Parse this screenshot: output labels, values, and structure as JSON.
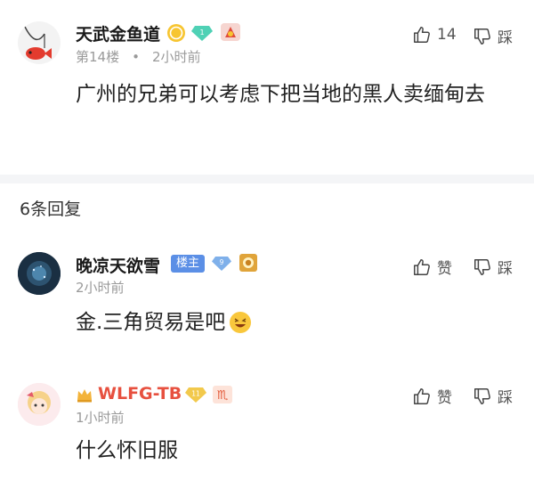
{
  "post": {
    "username": "天武金鱼道",
    "floor": "第14楼",
    "time": "2小时前",
    "content": "广州的兄弟可以考虑下把当地的黑人卖缅甸去",
    "like_count": "14",
    "dislike_label": "踩"
  },
  "replies_header": "6条回复",
  "replies": [
    {
      "username": "晚凉天欲雪",
      "owner_badge": "楼主",
      "level": "9",
      "time": "2小时前",
      "content": "金.三角贸易是吧",
      "like_label": "赞",
      "dislike_label": "踩"
    },
    {
      "username": "WLFG-TB",
      "level": "11",
      "time": "1小时前",
      "content": "什么怀旧服",
      "like_label": "赞",
      "dislike_label": "踩"
    }
  ],
  "colors": {
    "name_red": "#e7503f",
    "owner_badge_bg": "#5b8fe6",
    "meta_gray": "#9a9a9a",
    "divider": "#f4f5f7"
  }
}
